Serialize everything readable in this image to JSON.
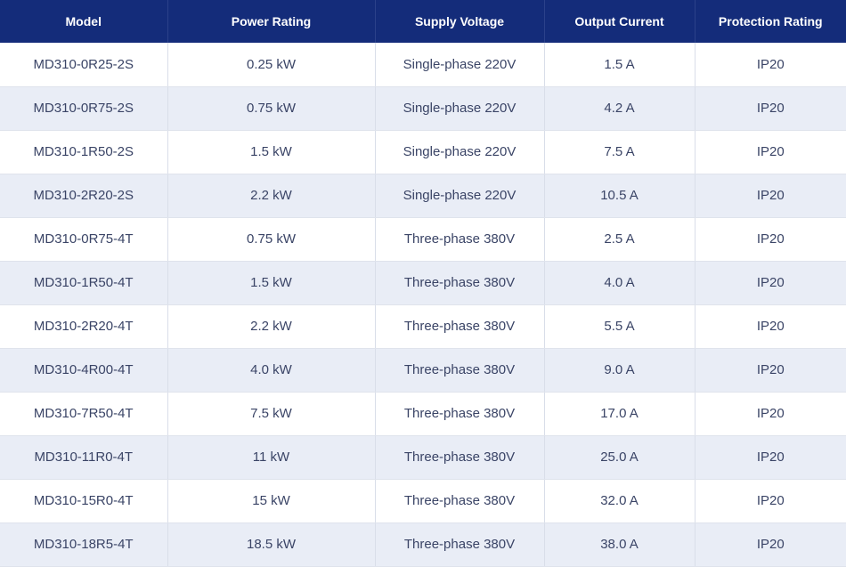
{
  "table": {
    "headers": [
      "Model",
      "Power Rating",
      "Supply Voltage",
      "Output Current",
      "Protection Rating"
    ],
    "rows": [
      [
        "MD310-0R25-2S",
        "0.25 kW",
        "Single-phase 220V",
        "1.5 A",
        "IP20"
      ],
      [
        "MD310-0R75-2S",
        "0.75 kW",
        "Single-phase 220V",
        "4.2 A",
        "IP20"
      ],
      [
        "MD310-1R50-2S",
        "1.5 kW",
        "Single-phase 220V",
        "7.5 A",
        "IP20"
      ],
      [
        "MD310-2R20-2S",
        "2.2 kW",
        "Single-phase 220V",
        "10.5 A",
        "IP20"
      ],
      [
        "MD310-0R75-4T",
        "0.75 kW",
        "Three-phase 380V",
        "2.5 A",
        "IP20"
      ],
      [
        "MD310-1R50-4T",
        "1.5 kW",
        "Three-phase 380V",
        "4.0 A",
        "IP20"
      ],
      [
        "MD310-2R20-4T",
        "2.2 kW",
        "Three-phase 380V",
        "5.5 A",
        "IP20"
      ],
      [
        "MD310-4R00-4T",
        "4.0 kW",
        "Three-phase 380V",
        "9.0 A",
        "IP20"
      ],
      [
        "MD310-7R50-4T",
        "7.5 kW",
        "Three-phase 380V",
        "17.0 A",
        "IP20"
      ],
      [
        "MD310-11R0-4T",
        "11 kW",
        "Three-phase 380V",
        "25.0 A",
        "IP20"
      ],
      [
        "MD310-15R0-4T",
        "15 kW",
        "Three-phase 380V",
        "32.0 A",
        "IP20"
      ],
      [
        "MD310-18R5-4T",
        "18.5 kW",
        "Three-phase 380V",
        "38.0 A",
        "IP20"
      ]
    ]
  },
  "colors": {
    "header_bg": "#142c7a",
    "header_text": "#ffffff",
    "row_alt_bg": "#e9edf6",
    "body_text": "#3a4466"
  }
}
